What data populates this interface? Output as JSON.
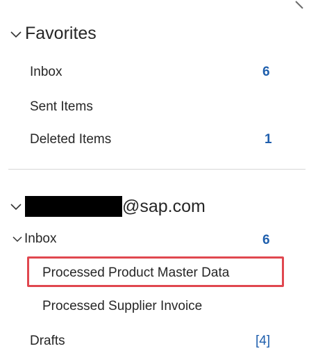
{
  "favorites": {
    "title": "Favorites",
    "items": [
      {
        "label": "Inbox",
        "count": "6"
      },
      {
        "label": "Sent Items",
        "count": ""
      },
      {
        "label": "Deleted Items",
        "count": "1"
      }
    ]
  },
  "account": {
    "email_domain": "@sap.com",
    "inbox": {
      "label": "Inbox",
      "count": "6"
    },
    "subfolders": [
      {
        "label": "Processed Product Master Data",
        "highlighted": true
      },
      {
        "label": "Processed Supplier Invoice",
        "highlighted": false
      }
    ],
    "drafts": {
      "label": "Drafts",
      "count": "[4]"
    }
  },
  "colors": {
    "count": "#1f5fad",
    "highlight": "#e0474f",
    "text": "#262626"
  }
}
